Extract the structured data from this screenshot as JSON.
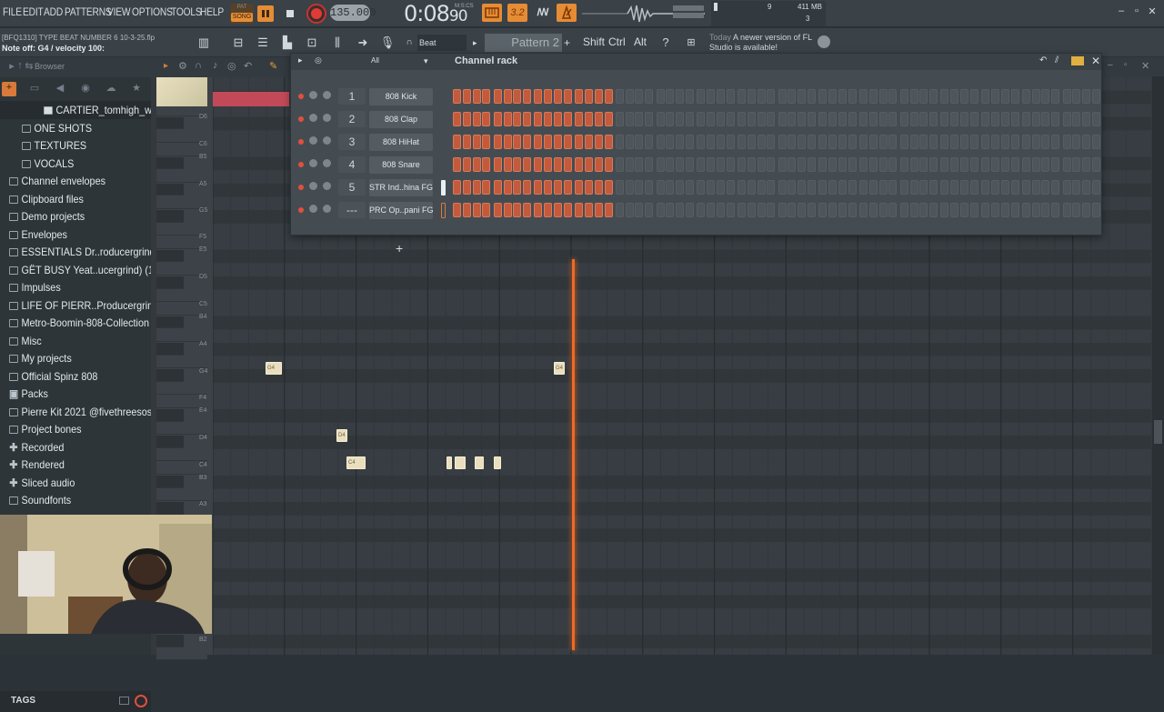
{
  "menu": [
    "FILE",
    "EDIT",
    "ADD",
    "PATTERNS",
    "VIEW",
    "OPTIONS",
    "TOOLS",
    "HELP"
  ],
  "transport": {
    "pat_label": "PAT",
    "song_label": "SONG",
    "tempo": "135.000",
    "time": "0:08",
    "time_sub": "90",
    "time_unit": "M:S:CS",
    "step_label": "3.2",
    "loop_label": "ꟿ"
  },
  "monitor": {
    "cpu": "9",
    "memory": "411 MB",
    "polyphony": "3"
  },
  "window_controls": [
    "–",
    "▫",
    "✕"
  ],
  "toolbar": {
    "file_title": "[BFQ1310] TYPE BEAT NUMBER 6 10-3-25.flp",
    "hint": "Note off: G4 / velocity 100:",
    "snap": "Beat",
    "pattern": "Pattern 2",
    "modifiers": [
      "Shift",
      "Ctrl",
      "Alt"
    ],
    "news_today": "Today",
    "news_text": "A newer version of FL Studio is available!"
  },
  "browser": {
    "label": "Browser",
    "items": [
      {
        "label": "CARTIER_tomhigh_wild",
        "type": "file",
        "indent": 1
      },
      {
        "label": "ONE SHOTS",
        "type": "folder",
        "indent": 1
      },
      {
        "label": "TEXTURES",
        "type": "folder",
        "indent": 1
      },
      {
        "label": "VOCALS",
        "type": "folder",
        "indent": 1
      },
      {
        "label": "Channel envelopes",
        "type": "folder",
        "indent": 0
      },
      {
        "label": "Clipboard files",
        "type": "folder",
        "indent": 0
      },
      {
        "label": "Demo projects",
        "type": "folder",
        "indent": 0
      },
      {
        "label": "Envelopes",
        "type": "folder",
        "indent": 0
      },
      {
        "label": "ESSENTIALS Dr..roducergrind)",
        "type": "folder",
        "indent": 0
      },
      {
        "label": "GËT BUSY Yeat..ucergrind) (1)",
        "type": "folder",
        "indent": 0
      },
      {
        "label": "Impulses",
        "type": "folder",
        "indent": 0
      },
      {
        "label": "LIFE OF PIERR..Producergrind)",
        "type": "folder",
        "indent": 0
      },
      {
        "label": "Metro-Boomin-808-Collection",
        "type": "folder",
        "indent": 0
      },
      {
        "label": "Misc",
        "type": "folder",
        "indent": 0
      },
      {
        "label": "My projects",
        "type": "folder",
        "indent": 0
      },
      {
        "label": "Official Spinz 808",
        "type": "folder",
        "indent": 0
      },
      {
        "label": "Packs",
        "type": "packs",
        "indent": 0
      },
      {
        "label": "Pierre Kit 2021 @fivethreesosa",
        "type": "folder",
        "indent": 0
      },
      {
        "label": "Project bones",
        "type": "folder",
        "indent": 0
      },
      {
        "label": "Recorded",
        "type": "plus",
        "indent": 0
      },
      {
        "label": "Rendered",
        "type": "plus",
        "indent": 0
      },
      {
        "label": "Sliced audio",
        "type": "plus",
        "indent": 0
      },
      {
        "label": "Soundfonts",
        "type": "folder",
        "indent": 0
      }
    ],
    "tags_label": "TAGS"
  },
  "piano_roll": {
    "key_labels": [
      "D6",
      "C6",
      "B5",
      "A5",
      "G5",
      "F5",
      "E5",
      "D5",
      "C5",
      "B4",
      "A4",
      "G4",
      "F4",
      "E4",
      "D4",
      "C4",
      "B3",
      "A3",
      "B2"
    ],
    "notes": [
      {
        "label": "G4"
      },
      {
        "label": "G4"
      },
      {
        "label": "D4"
      },
      {
        "label": "C4"
      },
      {
        "label": ""
      },
      {
        "label": ""
      },
      {
        "label": ""
      },
      {
        "label": ""
      }
    ]
  },
  "channel_rack": {
    "title": "Channel rack",
    "filter": "All",
    "channels": [
      {
        "num": "1",
        "name": "808 Kick"
      },
      {
        "num": "2",
        "name": "808 Clap"
      },
      {
        "num": "3",
        "name": "808 HiHat"
      },
      {
        "num": "4",
        "name": "808 Snare"
      },
      {
        "num": "5",
        "name": "STR Ind..hina FG"
      },
      {
        "num": "---",
        "name": "PRC Op..pani FG"
      }
    ],
    "steps_per_row": 64,
    "active_steps": 16,
    "colors": {
      "step_on": "#c45a3c",
      "step_off": "#4e565c",
      "accent": "#e58c35",
      "playhead": "#ee6a24"
    }
  }
}
